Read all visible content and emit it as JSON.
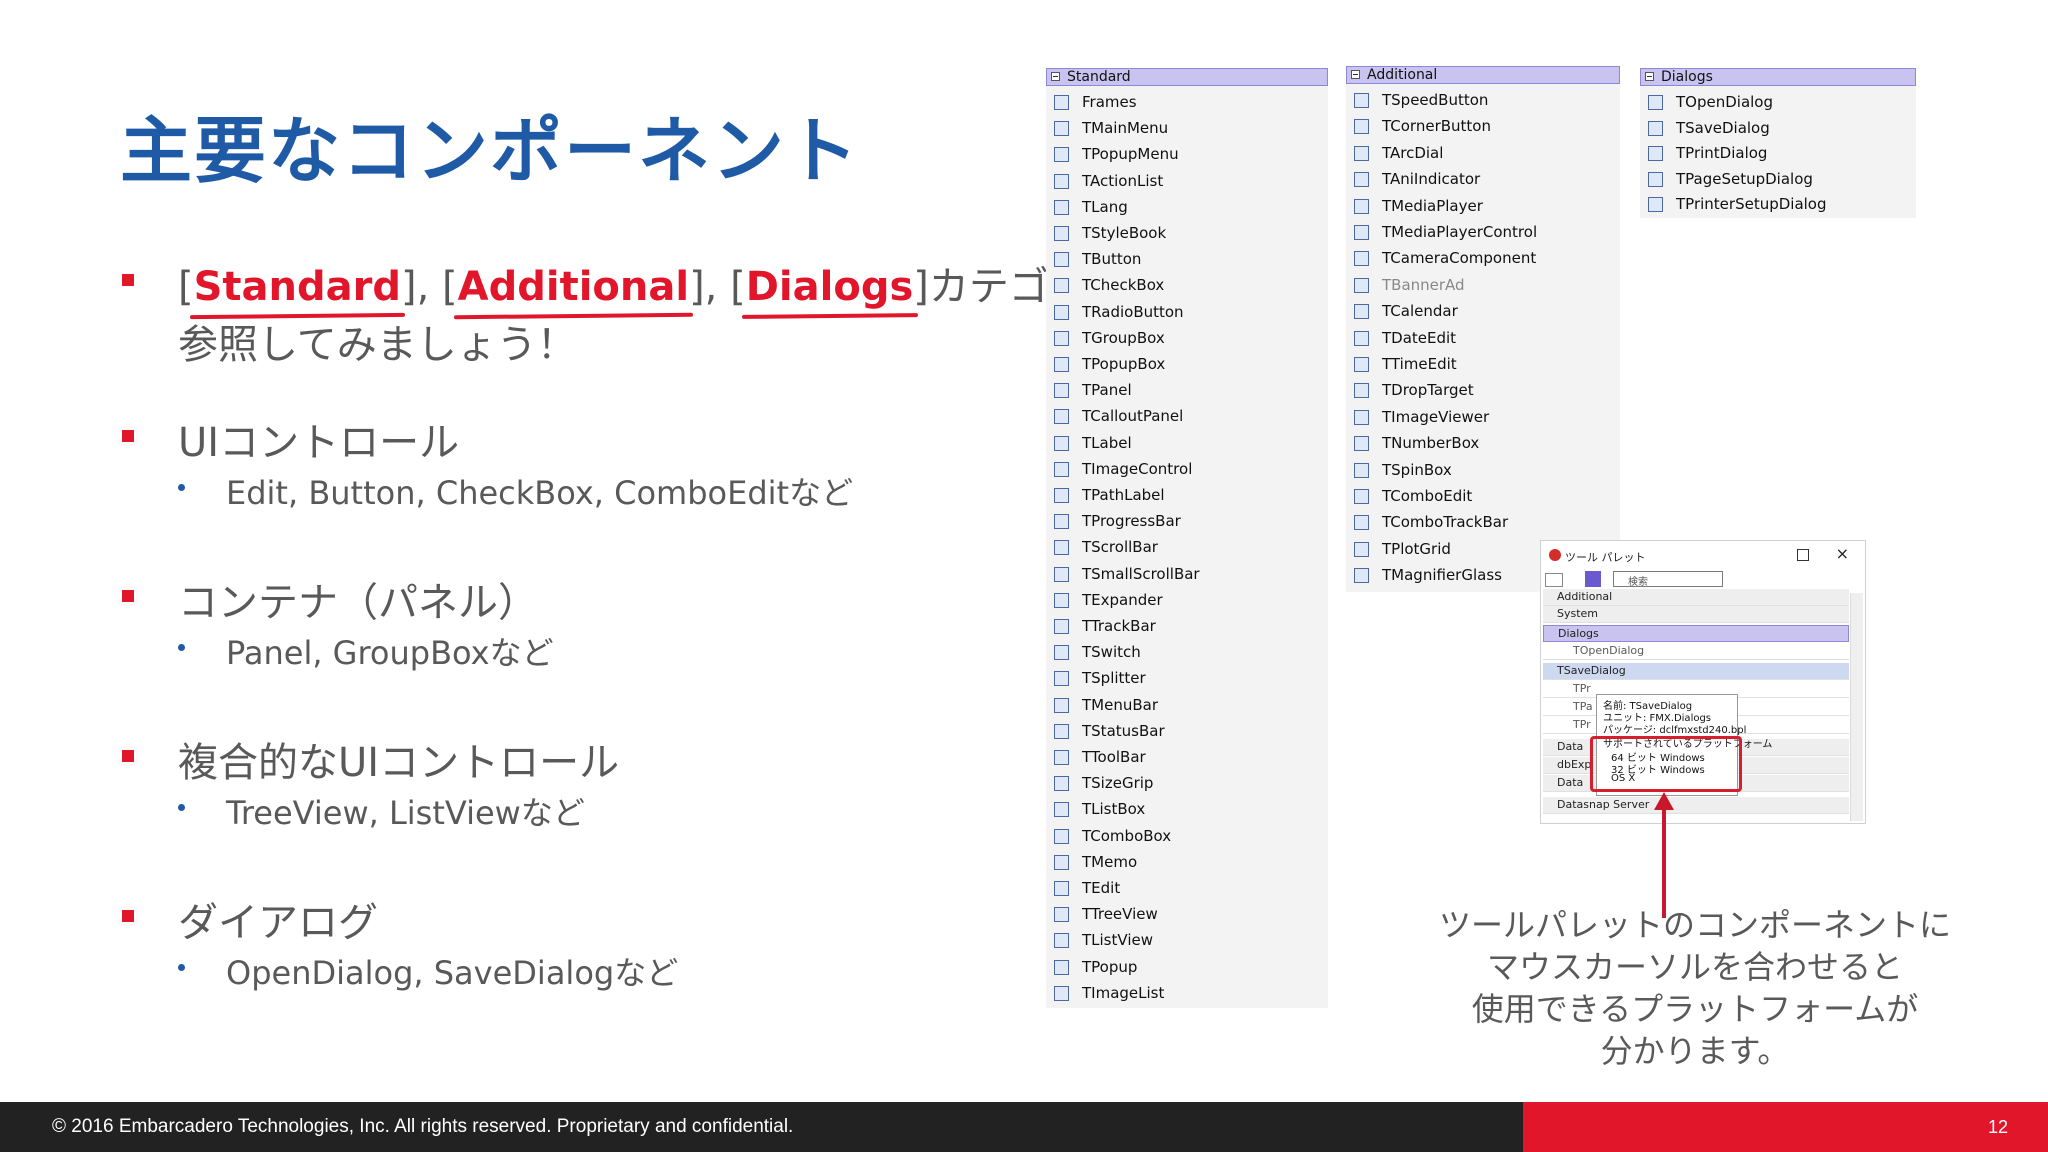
{
  "title": "主要なコンポーネント",
  "bullets": [
    {
      "pre": "[",
      "h1": "Standard",
      "m1": "], [",
      "h2": "Additional",
      "m2": "], [",
      "h3": "Dialogs",
      "post": "]カテゴリから",
      "line2": "参照してみましょう！"
    },
    {
      "text": "UIコントロール",
      "sub": "Edit, Button, CheckBox, ComboEditなど"
    },
    {
      "text": "コンテナ（パネル）",
      "sub": "Panel, GroupBoxなど"
    },
    {
      "text": "複合的なUIコントロール",
      "sub": "TreeView, ListViewなど"
    },
    {
      "text": "ダイアログ",
      "sub": "OpenDialog, SaveDialogなど"
    }
  ],
  "palette_standard": {
    "header": "Standard",
    "items": [
      "Frames",
      "TMainMenu",
      "TPopupMenu",
      "TActionList",
      "TLang",
      "TStyleBook",
      "TButton",
      "TCheckBox",
      "TRadioButton",
      "TGroupBox",
      "TPopupBox",
      "TPanel",
      "TCalloutPanel",
      "TLabel",
      "TImageControl",
      "TPathLabel",
      "TProgressBar",
      "TScrollBar",
      "TSmallScrollBar",
      "TExpander",
      "TTrackBar",
      "TSwitch",
      "TSplitter",
      "TMenuBar",
      "TStatusBar",
      "TToolBar",
      "TSizeGrip",
      "TListBox",
      "TComboBox",
      "TMemo",
      "TEdit",
      "TTreeView",
      "TListView",
      "TPopup",
      "TImageList"
    ]
  },
  "palette_additional": {
    "header": "Additional",
    "items": [
      "TSpeedButton",
      "TCornerButton",
      "TArcDial",
      "TAniIndicator",
      "TMediaPlayer",
      "TMediaPlayerControl",
      "TCameraComponent",
      "TBannerAd",
      "TCalendar",
      "TDateEdit",
      "TTimeEdit",
      "TDropTarget",
      "TImageViewer",
      "TNumberBox",
      "TSpinBox",
      "TComboEdit",
      "TComboTrackBar",
      "TPlotGrid",
      "TMagnifierGlass"
    ]
  },
  "palette_dialogs": {
    "header": "Dialogs",
    "items": [
      "TOpenDialog",
      "TSaveDialog",
      "TPrintDialog",
      "TPageSetupDialog",
      "TPrinterSetupDialog"
    ]
  },
  "tool_palette": {
    "title": "ツール パレット",
    "search": "検索",
    "rows": [
      "Additional",
      "System",
      "Dialogs",
      "TOpenDialog",
      "TSaveDialog",
      "TPr",
      "TPa",
      "TPr",
      "Data",
      "dbExp",
      "Data",
      "Datasnap Server"
    ],
    "tooltip": [
      "名前: TSaveDialog",
      "ユニット: FMX.Dialogs",
      "パッケージ: dclfmxstd240.bpl",
      "サポートされているプラットフォーム",
      "64 ビット Windows",
      "32 ビット Windows",
      "OS X"
    ]
  },
  "caption": [
    "ツールパレットのコンポーネントに",
    "マウスカーソルを合わせると",
    "使用できるプラットフォームが",
    "分かります。"
  ],
  "footer": {
    "copyright": "© 2016 Embarcadero Technologies, Inc. All rights reserved. Proprietary and confidential.",
    "page": "12"
  },
  "colors": {
    "accent_blue": "#1f5aa6",
    "accent_red": "#e2162b",
    "palette_header": "#c9c4ef"
  }
}
